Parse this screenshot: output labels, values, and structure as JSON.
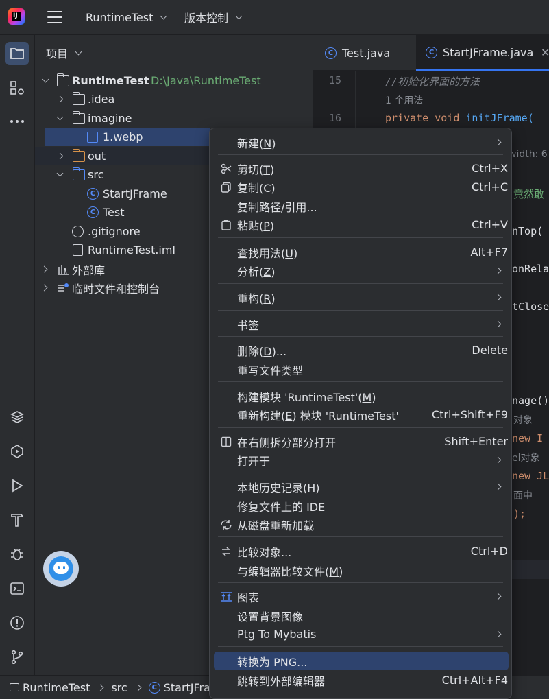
{
  "titlebar": {
    "logo_text": "IJ",
    "project_name": "RuntimeTest",
    "vcs_label": "版本控制"
  },
  "project_panel": {
    "header": "项目",
    "tree": [
      {
        "label": "RuntimeTest",
        "extra": "D:\\Java\\RuntimeTest"
      },
      {
        "label": ".idea"
      },
      {
        "label": "imagine"
      },
      {
        "label": "1.webp"
      },
      {
        "label": "out"
      },
      {
        "label": "src"
      },
      {
        "label": "StartJFrame"
      },
      {
        "label": "Test"
      },
      {
        "label": ".gitignore"
      },
      {
        "label": "RuntimeTest.iml"
      },
      {
        "label": "外部库"
      },
      {
        "label": "临时文件和控制台"
      }
    ]
  },
  "editor": {
    "tabs": [
      {
        "label": "Test.java"
      },
      {
        "label": "StartJFrame.java"
      }
    ],
    "line_numbers": [
      "15",
      "16"
    ],
    "code": {
      "comment": "//初始化界面的方法",
      "usage_hint": "1 个用法",
      "kw_private": "private",
      "kw_void": "void",
      "method": "initJFrame(",
      "frag_width": "width: 6",
      "frag_comment2": "竟然敢",
      "frag_ontop": "nTop(",
      "frag_rela": "onRela",
      "frag_close": "tClose",
      "frag_image": "nage()",
      "frag_obj": "对象",
      "frag_new1": "new I",
      "frag_label": "el对象",
      "frag_new2": "new JL",
      "frag_mid": "面中",
      "frag_end": ");"
    }
  },
  "context_menu": {
    "items": [
      {
        "label": "新建(",
        "mn": "N",
        "tail": ")",
        "shortcut": "",
        "submenu": true,
        "icon": ""
      },
      {
        "label": "剪切(",
        "mn": "T",
        "tail": ")",
        "shortcut": "Ctrl+X",
        "submenu": false,
        "icon": "scissors"
      },
      {
        "label": "复制(",
        "mn": "C",
        "tail": ")",
        "shortcut": "Ctrl+C",
        "submenu": false,
        "icon": "copy"
      },
      {
        "label": "复制路径/引用...",
        "mn": "",
        "tail": "",
        "shortcut": "",
        "submenu": false,
        "icon": ""
      },
      {
        "label": "粘贴(",
        "mn": "P",
        "tail": ")",
        "shortcut": "Ctrl+V",
        "submenu": false,
        "icon": "paste"
      },
      {
        "label": "查找用法(",
        "mn": "U",
        "tail": ")",
        "shortcut": "Alt+F7",
        "submenu": false,
        "icon": ""
      },
      {
        "label": "分析(",
        "mn": "Z",
        "tail": ")",
        "shortcut": "",
        "submenu": true,
        "icon": ""
      },
      {
        "label": "重构(",
        "mn": "R",
        "tail": ")",
        "shortcut": "",
        "submenu": true,
        "icon": ""
      },
      {
        "label": "书签",
        "mn": "",
        "tail": "",
        "shortcut": "",
        "submenu": true,
        "icon": ""
      },
      {
        "label": "删除(",
        "mn": "D",
        "tail": ")...",
        "shortcut": "Delete",
        "submenu": false,
        "icon": ""
      },
      {
        "label": "重写文件类型",
        "mn": "",
        "tail": "",
        "shortcut": "",
        "submenu": false,
        "icon": ""
      },
      {
        "label": "构建模块 'RuntimeTest'(",
        "mn": "M",
        "tail": ")",
        "shortcut": "",
        "submenu": false,
        "icon": ""
      },
      {
        "label": "重新构建(",
        "mn": "E",
        "tail": ") 模块 'RuntimeTest'",
        "shortcut": "Ctrl+Shift+F9",
        "submenu": false,
        "icon": ""
      },
      {
        "label": "在右侧拆分部分打开",
        "mn": "",
        "tail": "",
        "shortcut": "Shift+Enter",
        "submenu": false,
        "icon": "split"
      },
      {
        "label": "打开于",
        "mn": "",
        "tail": "",
        "shortcut": "",
        "submenu": true,
        "icon": ""
      },
      {
        "label": "本地历史记录(",
        "mn": "H",
        "tail": ")",
        "shortcut": "",
        "submenu": true,
        "icon": ""
      },
      {
        "label": "修复文件上的 IDE",
        "mn": "",
        "tail": "",
        "shortcut": "",
        "submenu": false,
        "icon": ""
      },
      {
        "label": "从磁盘重新加载",
        "mn": "",
        "tail": "",
        "shortcut": "",
        "submenu": false,
        "icon": "reload"
      },
      {
        "label": "比较对象...",
        "mn": "",
        "tail": "",
        "shortcut": "Ctrl+D",
        "submenu": false,
        "icon": "compare"
      },
      {
        "label": "与编辑器比较文件(",
        "mn": "M",
        "tail": ")",
        "shortcut": "",
        "submenu": false,
        "icon": ""
      },
      {
        "label": "图表",
        "mn": "",
        "tail": "",
        "shortcut": "",
        "submenu": true,
        "icon": "diagram"
      },
      {
        "label": "设置背景图像",
        "mn": "",
        "tail": "",
        "shortcut": "",
        "submenu": false,
        "icon": ""
      },
      {
        "label": "Ptg To Mybatis",
        "mn": "",
        "tail": "",
        "shortcut": "",
        "submenu": true,
        "icon": ""
      },
      {
        "label": "转换为 PNG...",
        "mn": "",
        "tail": "",
        "shortcut": "",
        "submenu": false,
        "icon": "",
        "highlighted": true
      },
      {
        "label": "跳转到外部编辑器",
        "mn": "",
        "tail": "",
        "shortcut": "Ctrl+Alt+F4",
        "submenu": false,
        "icon": ""
      }
    ]
  },
  "statusbar": {
    "crumbs": [
      "RuntimeTest",
      "src",
      "StartJFra"
    ]
  },
  "colors": {
    "accent": "#3574f0",
    "selection": "#2e436e",
    "keyword": "#cf8e6d",
    "method": "#56a8f5",
    "path_green": "#6aab73"
  }
}
